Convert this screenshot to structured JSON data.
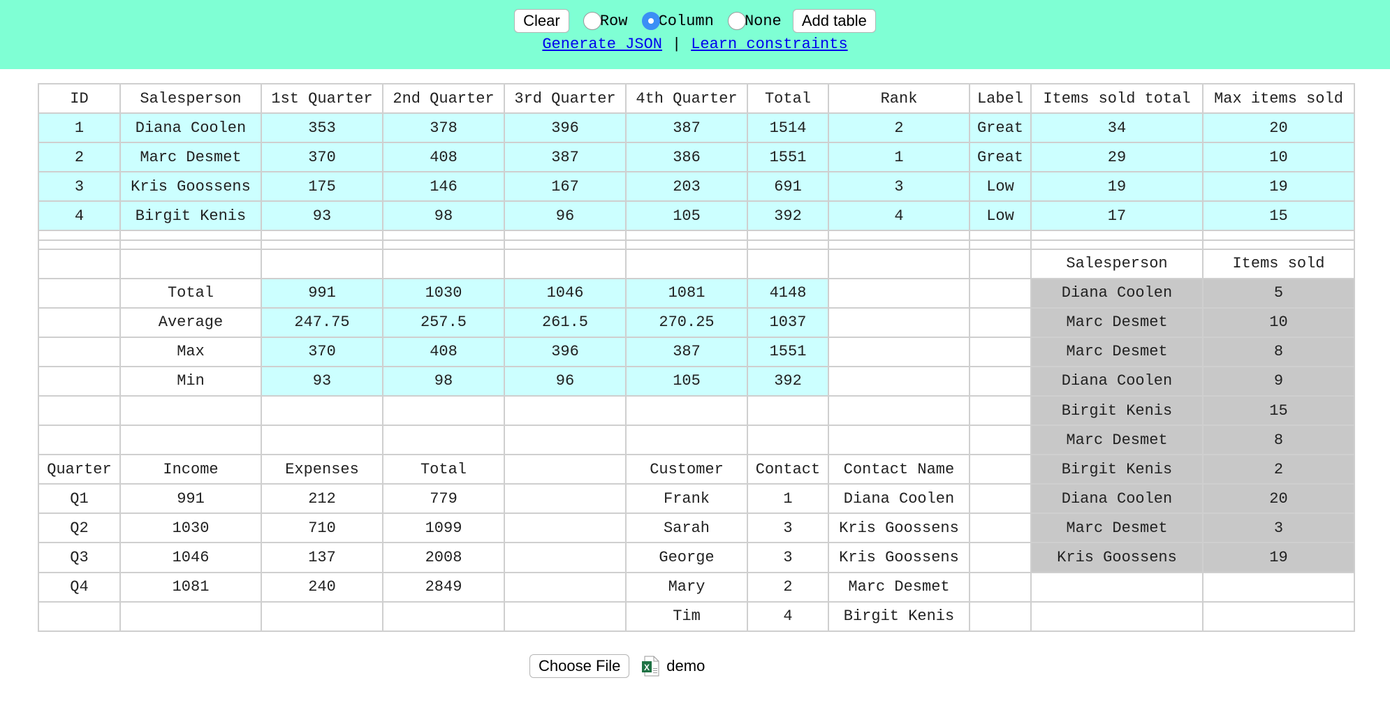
{
  "toolbar": {
    "clear": "Clear",
    "radios": [
      {
        "label": "Row",
        "selected": false
      },
      {
        "label": "Column",
        "selected": true
      },
      {
        "label": "None",
        "selected": false
      }
    ],
    "add_table": "Add table",
    "generate_json": "Generate JSON",
    "separator": "|",
    "learn_constraints": "Learn constraints"
  },
  "sales_table": {
    "headers": [
      "ID",
      "Salesperson",
      "1st Quarter",
      "2nd Quarter",
      "3rd Quarter",
      "4th Quarter",
      "Total",
      "Rank",
      "Label",
      "Items sold total",
      "Max items sold"
    ],
    "rows": [
      [
        "1",
        "Diana Coolen",
        "353",
        "378",
        "396",
        "387",
        "1514",
        "2",
        "Great",
        "34",
        "20"
      ],
      [
        "2",
        "Marc Desmet",
        "370",
        "408",
        "387",
        "386",
        "1551",
        "1",
        "Great",
        "29",
        "10"
      ],
      [
        "3",
        "Kris Goossens",
        "175",
        "146",
        "167",
        "203",
        "691",
        "3",
        "Low",
        "19",
        "19"
      ],
      [
        "4",
        "Birgit Kenis",
        "93",
        "98",
        "96",
        "105",
        "392",
        "4",
        "Low",
        "17",
        "15"
      ]
    ]
  },
  "summary_table": {
    "rows": [
      [
        "Total",
        "991",
        "1030",
        "1046",
        "1081",
        "4148"
      ],
      [
        "Average",
        "247.75",
        "257.5",
        "261.5",
        "270.25",
        "1037"
      ],
      [
        "Max",
        "370",
        "408",
        "396",
        "387",
        "1551"
      ],
      [
        "Min",
        "93",
        "98",
        "96",
        "105",
        "392"
      ]
    ]
  },
  "items_table": {
    "headers": [
      "Salesperson",
      "Items sold"
    ],
    "rows": [
      [
        "Diana Coolen",
        "5"
      ],
      [
        "Marc Desmet",
        "10"
      ],
      [
        "Marc Desmet",
        "8"
      ],
      [
        "Diana Coolen",
        "9"
      ],
      [
        "Birgit Kenis",
        "15"
      ],
      [
        "Marc Desmet",
        "8"
      ],
      [
        "Birgit Kenis",
        "2"
      ],
      [
        "Diana Coolen",
        "20"
      ],
      [
        "Marc Desmet",
        "3"
      ],
      [
        "Kris Goossens",
        "19"
      ]
    ]
  },
  "quarter_table": {
    "headers": [
      "Quarter",
      "Income",
      "Expenses",
      "Total"
    ],
    "rows": [
      [
        "Q1",
        "991",
        "212",
        "779"
      ],
      [
        "Q2",
        "1030",
        "710",
        "1099"
      ],
      [
        "Q3",
        "1046",
        "137",
        "2008"
      ],
      [
        "Q4",
        "1081",
        "240",
        "2849"
      ]
    ]
  },
  "customer_table": {
    "headers": [
      "Customer",
      "Contact",
      "Contact Name"
    ],
    "rows": [
      [
        "Frank",
        "1",
        "Diana Coolen"
      ],
      [
        "Sarah",
        "3",
        "Kris Goossens"
      ],
      [
        "George",
        "3",
        "Kris Goossens"
      ],
      [
        "Mary",
        "2",
        "Marc Desmet"
      ],
      [
        "Tim",
        "4",
        "Birgit Kenis"
      ]
    ]
  },
  "file": {
    "choose_label": "Choose File",
    "icon": "excel-file-icon",
    "file_name": "demo"
  },
  "colors": {
    "topbar": "#7fffd4",
    "cyan_cells": "#ccffff",
    "gray_cells": "#c8c8c8",
    "grid_border": "#cfcfcf",
    "radio_selected": "#3b8ff5"
  }
}
